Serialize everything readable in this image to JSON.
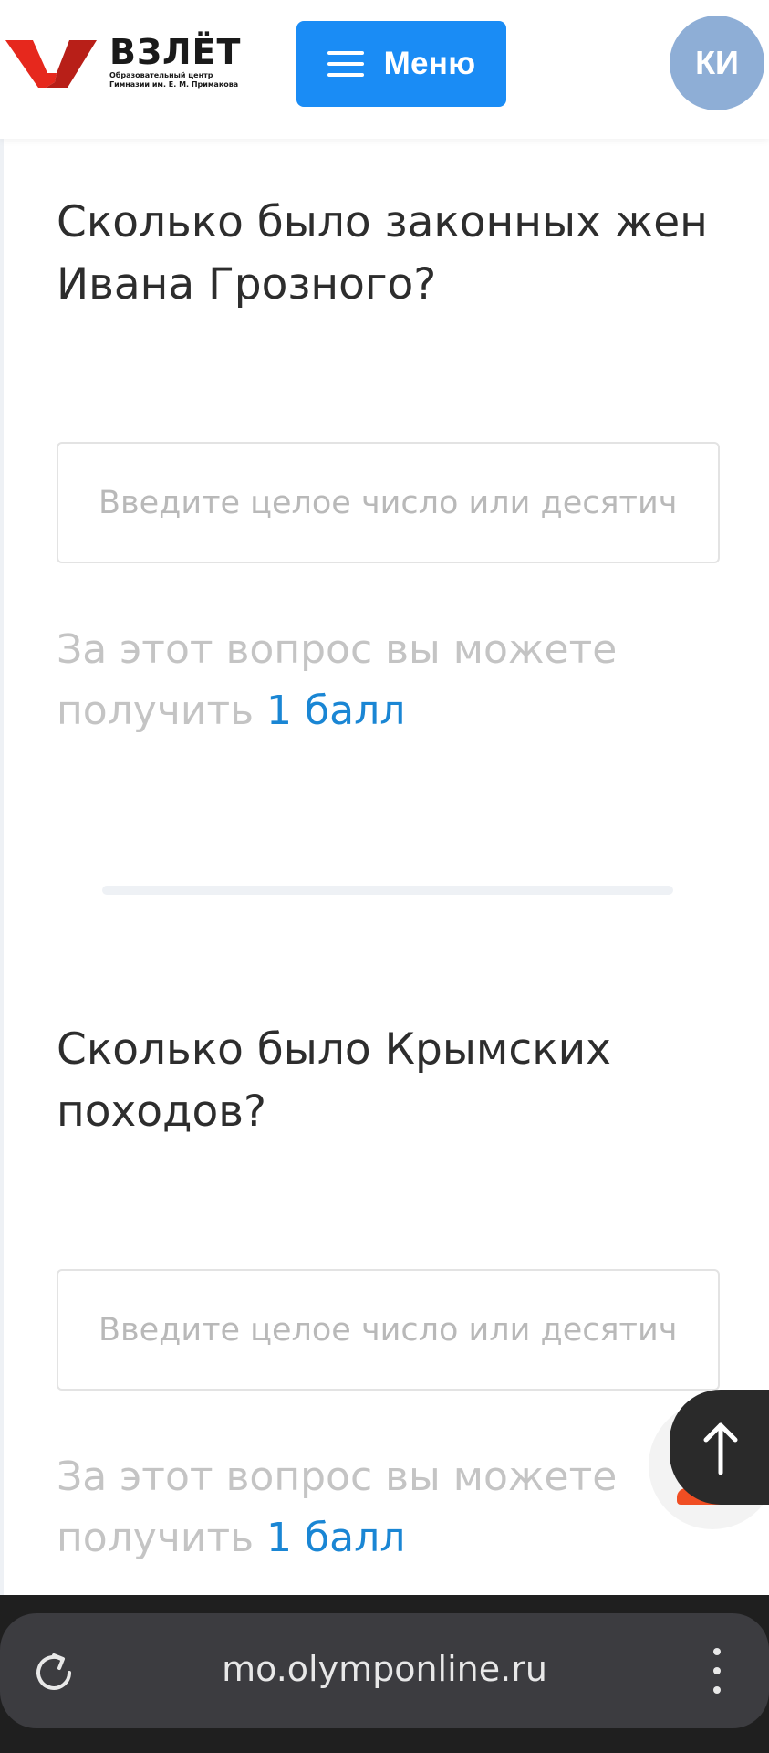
{
  "header": {
    "logo_name": "ВЗЛЁТ",
    "logo_sub_line1": "Образовательный центр",
    "logo_sub_line2": "Гимназии им. Е. М. Примакова",
    "menu_label": "Меню",
    "avatar_initials": "КИ",
    "brand_color": "#e6281d",
    "accent_color": "#1a8cf5"
  },
  "questions": [
    {
      "title": "Сколько было законных жен Ивана Грозного?",
      "input_placeholder": "Введите целое число или десятичную дробь",
      "input_value": "",
      "score_prefix": "За этот вопрос вы можете получить",
      "score_points": "1 балл"
    },
    {
      "title": "Сколько было Крымских походов?",
      "input_placeholder": "Введите целое число или десятичную дробь",
      "input_value": "",
      "score_prefix": "За этот вопрос вы можете получить",
      "score_points": "1 балл"
    }
  ],
  "browser": {
    "url": "mo.olymponline.ru"
  }
}
